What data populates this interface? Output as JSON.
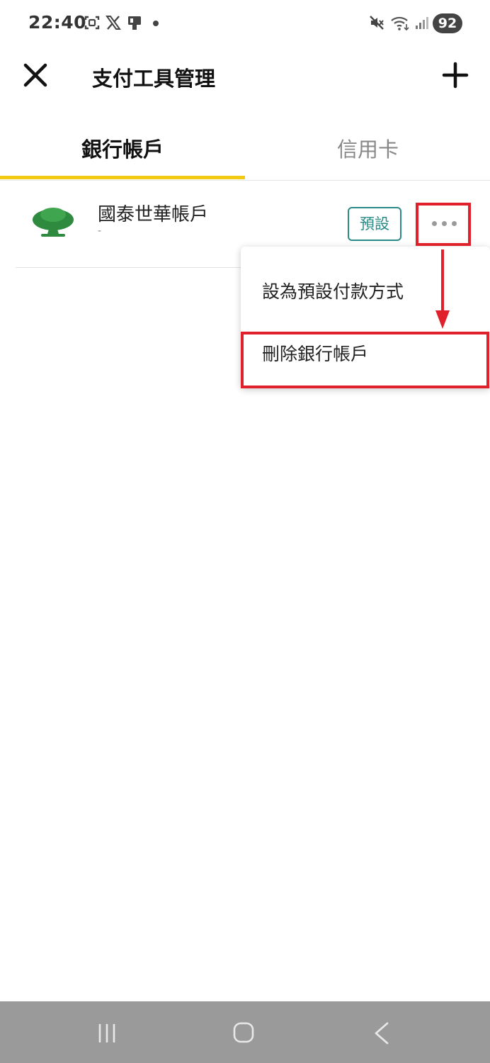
{
  "status_bar": {
    "time": "22:40",
    "battery": "92",
    "icons": [
      "screenshot-icon",
      "x-logo-icon",
      "cast-icon",
      "notification-dot",
      "mute-icon",
      "wifi-icon",
      "signal-icon",
      "battery-icon"
    ]
  },
  "header": {
    "title": "支付工具管理",
    "close_icon": "close-icon",
    "add_icon": "plus-icon"
  },
  "tabs": [
    {
      "label": "銀行帳戶",
      "active": true
    },
    {
      "label": "信用卡",
      "active": false
    }
  ],
  "account": {
    "name": "國泰世華帳戶",
    "sub": "-",
    "badge": "預設",
    "logo_icon": "tree-logo-icon",
    "more_icon": "more-dots-icon"
  },
  "menu": {
    "set_default": "設為預設付款方式",
    "delete": "刪除銀行帳戶"
  },
  "nav_bar": {
    "icons": [
      "recent-apps-icon",
      "home-icon",
      "back-icon"
    ]
  },
  "colors": {
    "tab_indicator": "#f2c913",
    "badge": "#2a8a86",
    "highlight": "#e0202b",
    "logo_green": "#2d8a3e",
    "nav_bar": "#9a9a9a"
  }
}
